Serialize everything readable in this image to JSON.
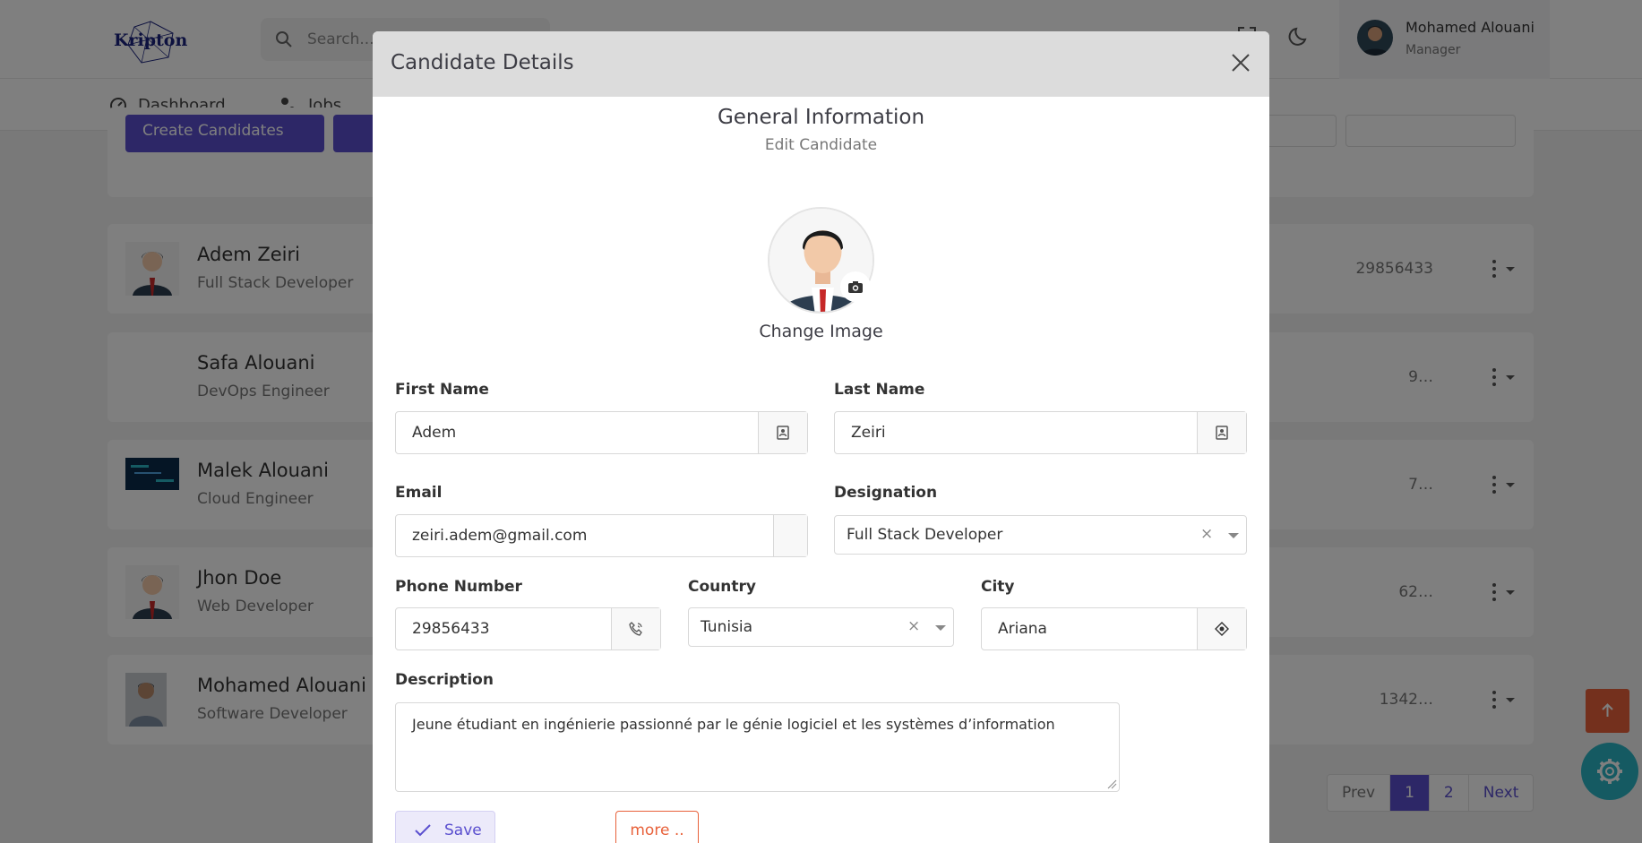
{
  "app": {
    "logo_text": "Kripton",
    "search_placeholder": "Search...",
    "profile": {
      "name": "Mohamed Alouani",
      "role": "Manager"
    },
    "nav": [
      {
        "label": "Dashboard",
        "icon": "dashboard-icon"
      },
      {
        "label": "Jobs",
        "icon": "jobs-icon"
      }
    ],
    "toolbar": {
      "create_label": "Create Candidates"
    },
    "candidates": [
      {
        "name": "Adem Zeiri",
        "role": "Full Stack Developer",
        "phone": "29856433",
        "avatar": "male-avatar"
      },
      {
        "name": "Safa Alouani",
        "role": "DevOps Engineer",
        "phone": "…9",
        "avatar": "none"
      },
      {
        "name": "Malek Alouani",
        "role": "Cloud Engineer",
        "phone": "…7",
        "avatar": "tech-banner"
      },
      {
        "name": "Jhon Doe",
        "role": "Web Developer",
        "phone": "…62",
        "avatar": "male-avatar"
      },
      {
        "name": "Mohamed Alouani",
        "role": "Software Developer",
        "phone": "…1342",
        "avatar": "photo"
      }
    ],
    "pagination": {
      "prev": "Prev",
      "pages": [
        "1",
        "2"
      ],
      "current": "1",
      "next": "Next"
    }
  },
  "modal": {
    "title": "Candidate Details",
    "section_title": "General Information",
    "section_subtitle": "Edit Candidate",
    "change_image": "Change Image",
    "fields": {
      "first_name": {
        "label": "First Name",
        "value": "Adem"
      },
      "last_name": {
        "label": "Last Name",
        "value": "Zeiri"
      },
      "email": {
        "label": "Email",
        "value": "zeiri.adem@gmail.com"
      },
      "designation": {
        "label": "Designation",
        "value": "Full Stack Developer"
      },
      "phone": {
        "label": "Phone Number",
        "value": "29856433"
      },
      "country": {
        "label": "Country",
        "value": "Tunisia"
      },
      "city": {
        "label": "City",
        "value": "Ariana"
      },
      "description": {
        "label": "Description",
        "value": "Jeune étudiant en ingénierie passionné par le génie logiciel et les systèmes d’information"
      }
    },
    "save_label": "Save",
    "more_label": "more .."
  },
  "colors": {
    "primary": "#5a4fcf",
    "accent": "#e8613a",
    "teal": "#2bb4c5"
  }
}
